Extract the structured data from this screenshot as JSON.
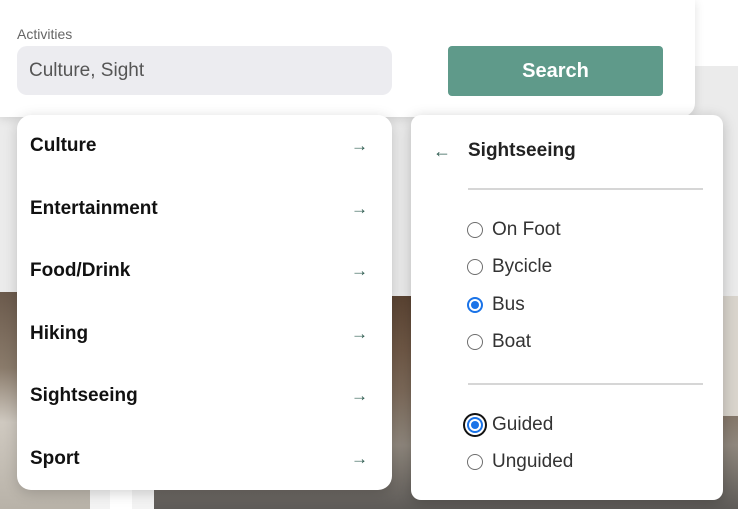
{
  "header": {
    "activities_label": "Activities",
    "activities_value": "Culture, Sight",
    "search_label": "Search"
  },
  "categories": [
    {
      "label": "Culture",
      "arrow": "→"
    },
    {
      "label": "Entertainment",
      "arrow": "→"
    },
    {
      "label": "Food/Drink",
      "arrow": "→"
    },
    {
      "label": "Hiking",
      "arrow": "→"
    },
    {
      "label": "Sightseeing",
      "arrow": "→"
    },
    {
      "label": "Sport",
      "arrow": "→"
    }
  ],
  "subpanel": {
    "back": "←",
    "title": "Sightseeing",
    "transport": [
      {
        "label": "On Foot",
        "checked": false
      },
      {
        "label": "Bycicle",
        "checked": false
      },
      {
        "label": "Bus",
        "checked": true
      },
      {
        "label": "Boat",
        "checked": false
      }
    ],
    "guide": [
      {
        "label": "Guided",
        "checked": true
      },
      {
        "label": "Unguided",
        "checked": false
      }
    ]
  },
  "colors": {
    "accent": "#5f9a8a",
    "radio_checked": "#1a73e8",
    "arrow": "#2e5c50"
  }
}
